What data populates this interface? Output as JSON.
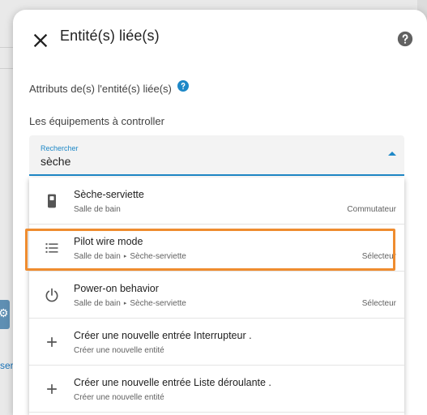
{
  "dialog": {
    "title": "Entité(s) liée(s)"
  },
  "attributes": {
    "label": "Attributs de(s) l'entité(s) liée(s)"
  },
  "equipment": {
    "label": "Les équipements à controller"
  },
  "search": {
    "label": "Rechercher",
    "value": "sèche"
  },
  "results": [
    {
      "title": "Sèche-serviette",
      "area": "Salle de bain",
      "device": "",
      "type": "Commutateur",
      "icon": "switch-icon"
    },
    {
      "title": "Pilot wire mode",
      "area": "Salle de bain",
      "device": "Sèche-serviette",
      "type": "Sélecteur",
      "icon": "list-icon"
    },
    {
      "title": "Power-on behavior",
      "area": "Salle de bain",
      "device": "Sèche-serviette",
      "type": "Sélecteur",
      "icon": "power-icon"
    },
    {
      "title": "Créer une nouvelle entrée Interrupteur .",
      "area": "Créer une nouvelle entité",
      "device": "",
      "type": "",
      "icon": "plus-icon"
    },
    {
      "title": "Créer une nouvelle entrée Liste déroulante .",
      "area": "Créer une nouvelle entité",
      "device": "",
      "type": "",
      "icon": "plus-icon"
    }
  ],
  "background": {
    "link_fragment": "serv"
  },
  "colors": {
    "accent": "#1e88c7",
    "highlight": "#ef8c2f"
  }
}
